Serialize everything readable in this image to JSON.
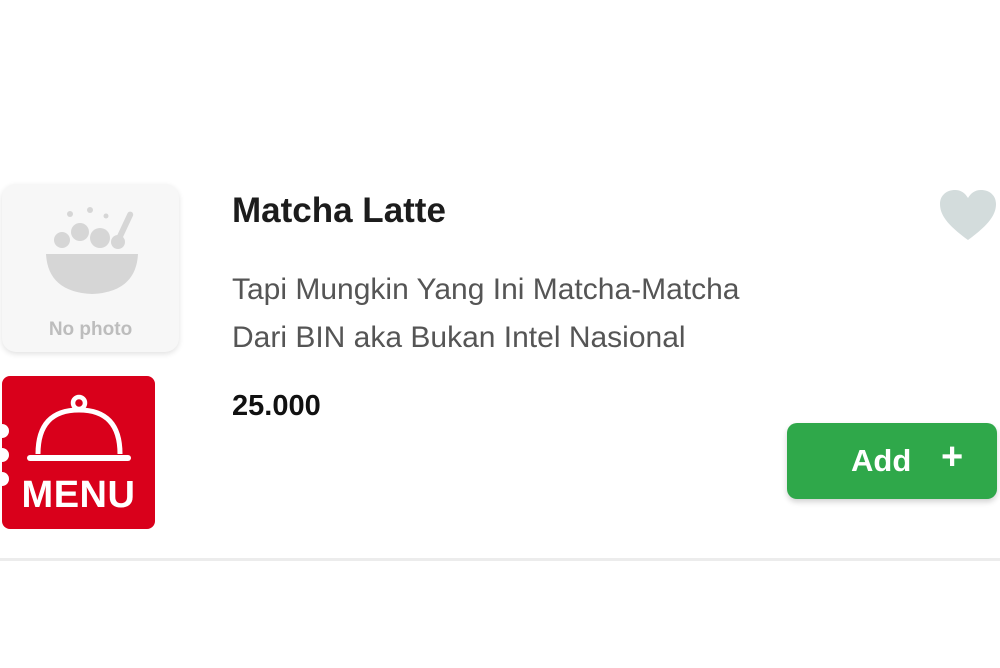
{
  "product": {
    "name": "Matcha Latte",
    "description_line1": "Tapi Mungkin Yang Ini Matcha-Matcha",
    "description_line2": "Dari BIN aka Bukan Intel Nasional",
    "price": "25.000",
    "image_placeholder": "No photo"
  },
  "badge": {
    "label": "MENU",
    "color": "#d9001b",
    "icon": "cloche-icon"
  },
  "actions": {
    "add_label": "Add",
    "add_symbol": "+",
    "add_color": "#2fa84a",
    "favorite_icon": "heart-icon"
  }
}
